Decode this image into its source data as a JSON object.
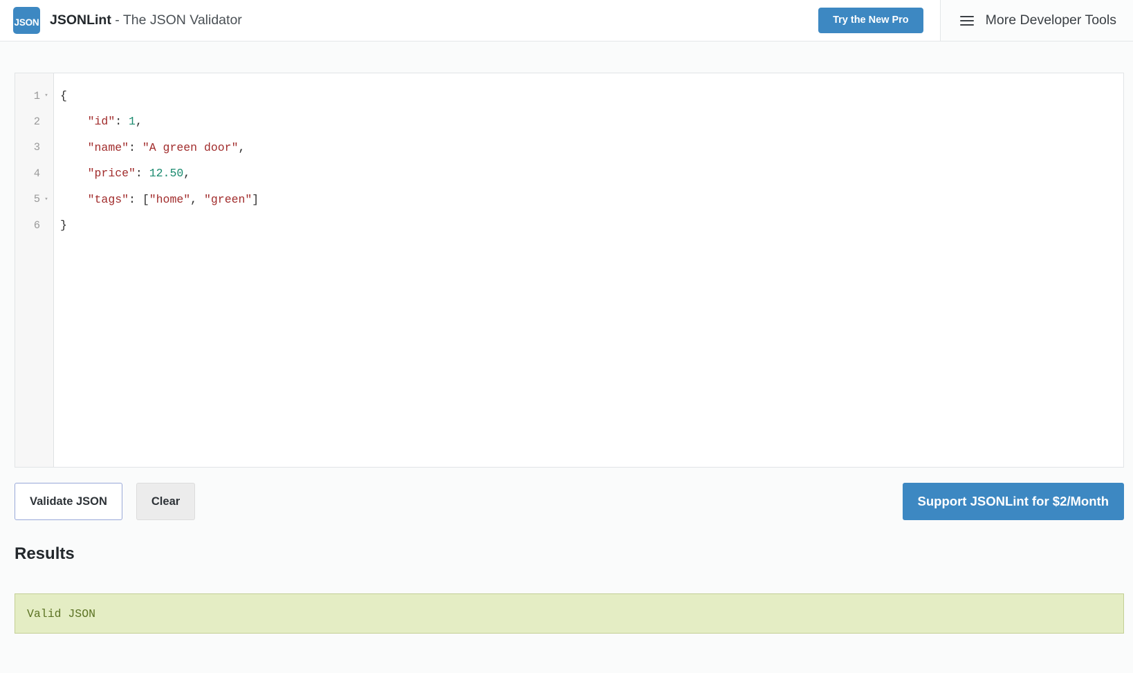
{
  "header": {
    "logo_text": "JSON",
    "logo_icon": "json-logo-icon",
    "brand_name": "JSONLint",
    "brand_tagline": " - The JSON Validator",
    "pro_button_label": "Try the New Pro",
    "menu_icon": "hamburger-menu-icon",
    "devtools_label": "More Developer Tools"
  },
  "editor": {
    "lines": [
      {
        "number": "1",
        "fold": "▾"
      },
      {
        "number": "2",
        "fold": ""
      },
      {
        "number": "3",
        "fold": ""
      },
      {
        "number": "4",
        "fold": ""
      },
      {
        "number": "5",
        "fold": "▾"
      },
      {
        "number": "6",
        "fold": ""
      }
    ],
    "code": {
      "l1_brace": "{",
      "l2_key": "\"id\"",
      "l2_colon": ": ",
      "l2_num": "1",
      "l2_comma": ",",
      "l3_key": "\"name\"",
      "l3_colon": ": ",
      "l3_str": "\"A green door\"",
      "l3_comma": ",",
      "l4_key": "\"price\"",
      "l4_colon": ": ",
      "l4_num": "12.50",
      "l4_comma": ",",
      "l5_key": "\"tags\"",
      "l5_colon": ": ",
      "l5_open": "[",
      "l5_str1": "\"home\"",
      "l5_sep": ", ",
      "l5_str2": "\"green\"",
      "l5_close": "]",
      "l6_brace": "}"
    },
    "raw_value": "{\n    \"id\": 1,\n    \"name\": \"A green door\",\n    \"price\": 12.50,\n    \"tags\": [\"home\", \"green\"]\n}"
  },
  "actions": {
    "validate_label": "Validate JSON",
    "clear_label": "Clear",
    "support_label": "Support JSONLint for $2/Month"
  },
  "results": {
    "title": "Results",
    "message": "Valid JSON"
  },
  "colors": {
    "brand_blue": "#3d88c2",
    "valid_bg": "#e4edc4",
    "valid_border": "#c3cf94",
    "valid_text": "#5c7324",
    "json_string": "#a12c2c",
    "json_number": "#1a8a6e",
    "focus_border": "#98a8d8"
  }
}
